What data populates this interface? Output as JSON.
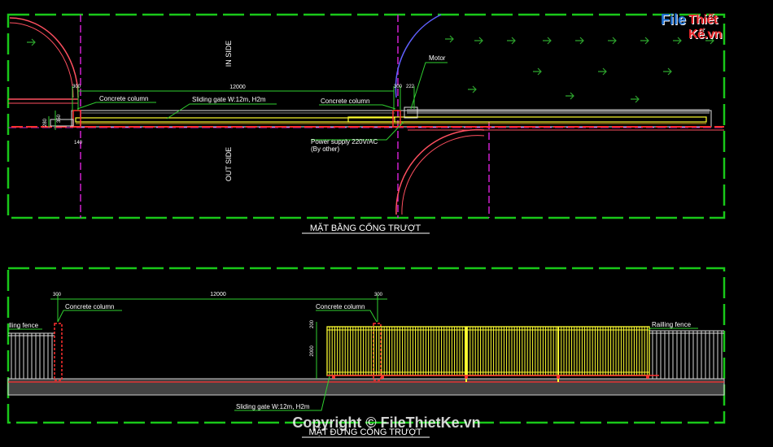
{
  "colors": {
    "frame": "#19c819",
    "dim": "#30d030",
    "text": "#ffffff",
    "gate": "#ffff30",
    "centerline": "#d020d0",
    "swing": "#ff5060",
    "swing_alt": "#6060ff",
    "column": "#ff3030",
    "fence": "#d8d8d8",
    "ground": "#bfbfbf",
    "wall": "#b0b0b0"
  },
  "plan": {
    "title": "MẶT BẰNG CỔNG TRƯỢT",
    "in_side": "IN SIDE",
    "out_side": "OUT SIDE",
    "concrete_column_left": "Concrete column",
    "concrete_column_right": "Concrete column",
    "sliding_gate": "Sliding gate W:12m, H2m",
    "motor": "Motor",
    "power_supply": "Power supply 220V/AC",
    "by_other": "(By other)",
    "dim_total": "12000",
    "dim_col_left": "300",
    "dim_col_right": "300",
    "dim_motor": "222",
    "dim_side_a": "280",
    "dim_side_b": "350",
    "dim_bottom": "140",
    "arrow_icon": "direction-arrow-icon"
  },
  "elevation": {
    "title": "MẶT ĐỨNG CỔNG TRƯỢT",
    "concrete_column_left": "Concrete column",
    "concrete_column_right": "Concrete column",
    "railling_fence_left": "lling fence",
    "railling_fence_right": "Railling fence",
    "sliding_gate": "Sliding gate W:12m, H2m",
    "dim_total": "12000",
    "dim_col_left": "300",
    "dim_col_right": "300",
    "dim_height": "2000",
    "dim_top": "200"
  },
  "branding": {
    "logo_file": "File",
    "logo_rest": "Thiết Kế.vn",
    "watermark": "Copyright © FileThietKe.vn"
  }
}
